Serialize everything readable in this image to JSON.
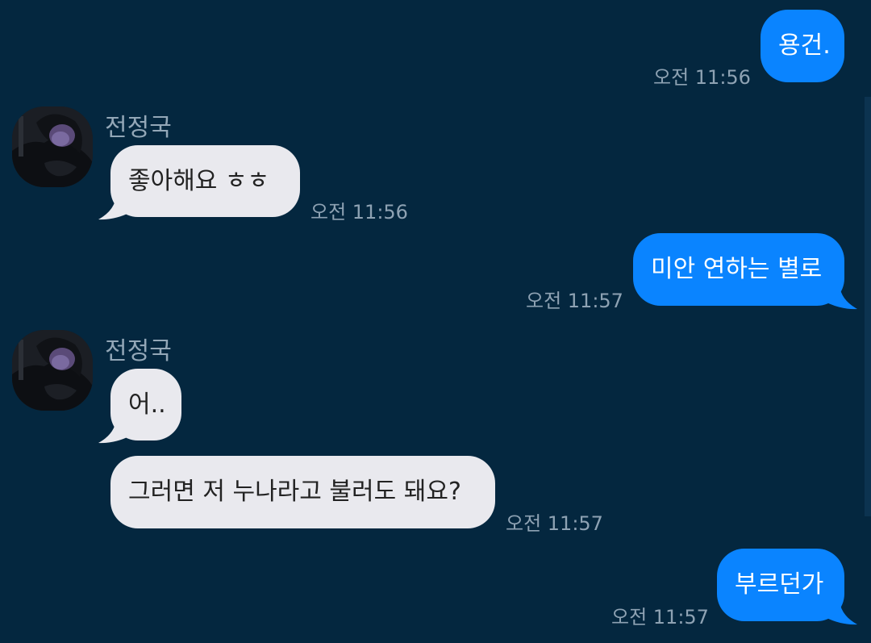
{
  "colors": {
    "background": "#04273f",
    "sent_bubble": "#0a84ff",
    "received_bubble": "#e9e9ee",
    "timestamp": "#8ea2b3",
    "sender_name": "#93a7b7"
  },
  "messages": [
    {
      "direction": "sent",
      "text": "용건.",
      "time": "오전 11:56"
    },
    {
      "direction": "received",
      "sender": "전정국",
      "text": "좋아해요 ㅎㅎ",
      "time": "오전 11:56"
    },
    {
      "direction": "sent",
      "text": "미안 연하는 별로",
      "time": "오전 11:57"
    },
    {
      "direction": "received",
      "sender": "전정국",
      "text": "어..",
      "time": ""
    },
    {
      "direction": "received",
      "text": "그러면 저 누나라고 불러도 돼요?",
      "time": "오전 11:57"
    },
    {
      "direction": "sent",
      "text": "부르던가",
      "time": "오전 11:57"
    }
  ],
  "icons": {
    "avatar": "profile-photo"
  }
}
